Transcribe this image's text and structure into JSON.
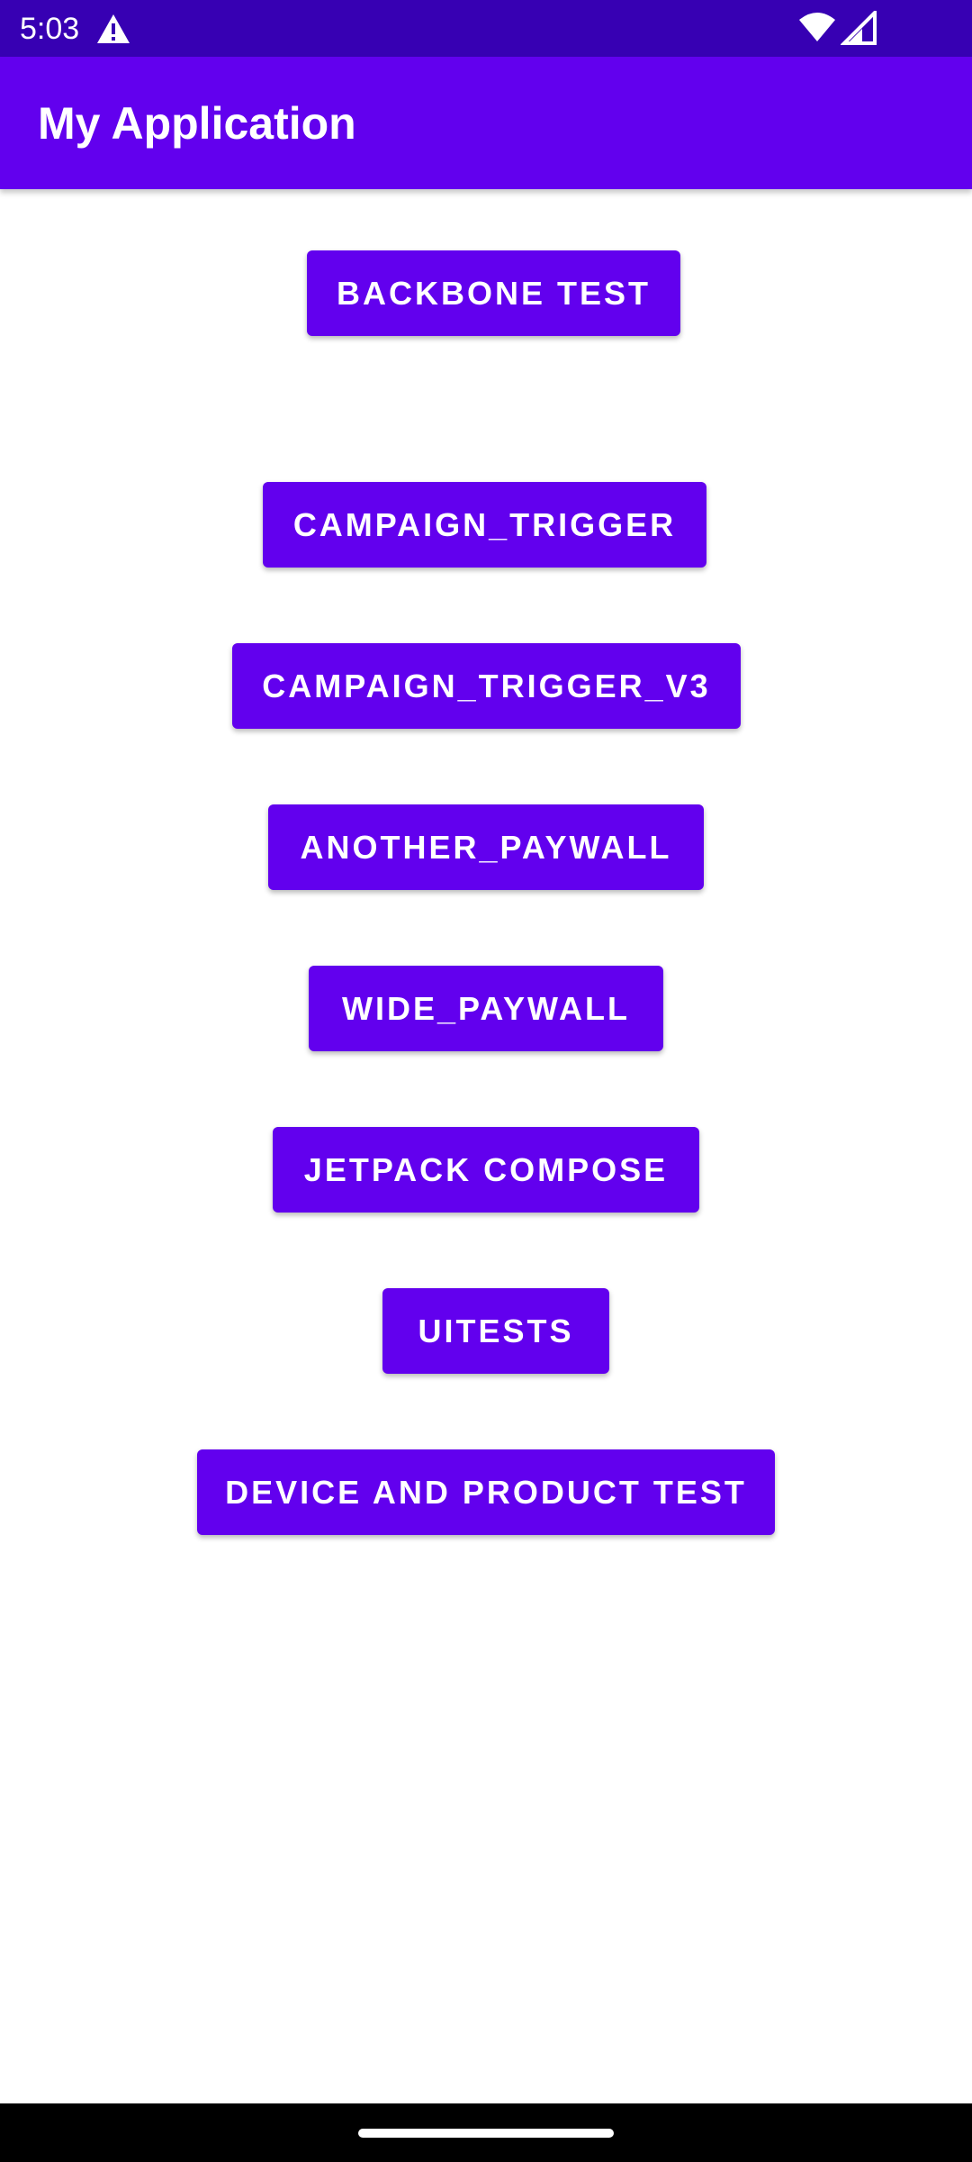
{
  "status_bar": {
    "time": "5:03",
    "icons": [
      "warning-icon",
      "wifi-icon",
      "signal-icon"
    ],
    "background": "#3700b3"
  },
  "app_bar": {
    "title": "My Application",
    "background": "#6200ee"
  },
  "buttons": {
    "backbone_test": "BACKBONE TEST",
    "campaign_trigger": "CAMPAIGN_TRIGGER",
    "campaign_trigger_v3": "CAMPAIGN_TRIGGER_V3",
    "another_paywall": "ANOTHER_PAYWALL",
    "wide_paywall": "WIDE_PAYWALL",
    "jetpack_compose": "JETPACK COMPOSE",
    "uitests": "UITESTS",
    "device_and_product_test": "DEVICE AND PRODUCT TEST"
  },
  "colors": {
    "accent": "#6200ee",
    "button_text": "#ffffff",
    "nav_bar": "#000000"
  }
}
